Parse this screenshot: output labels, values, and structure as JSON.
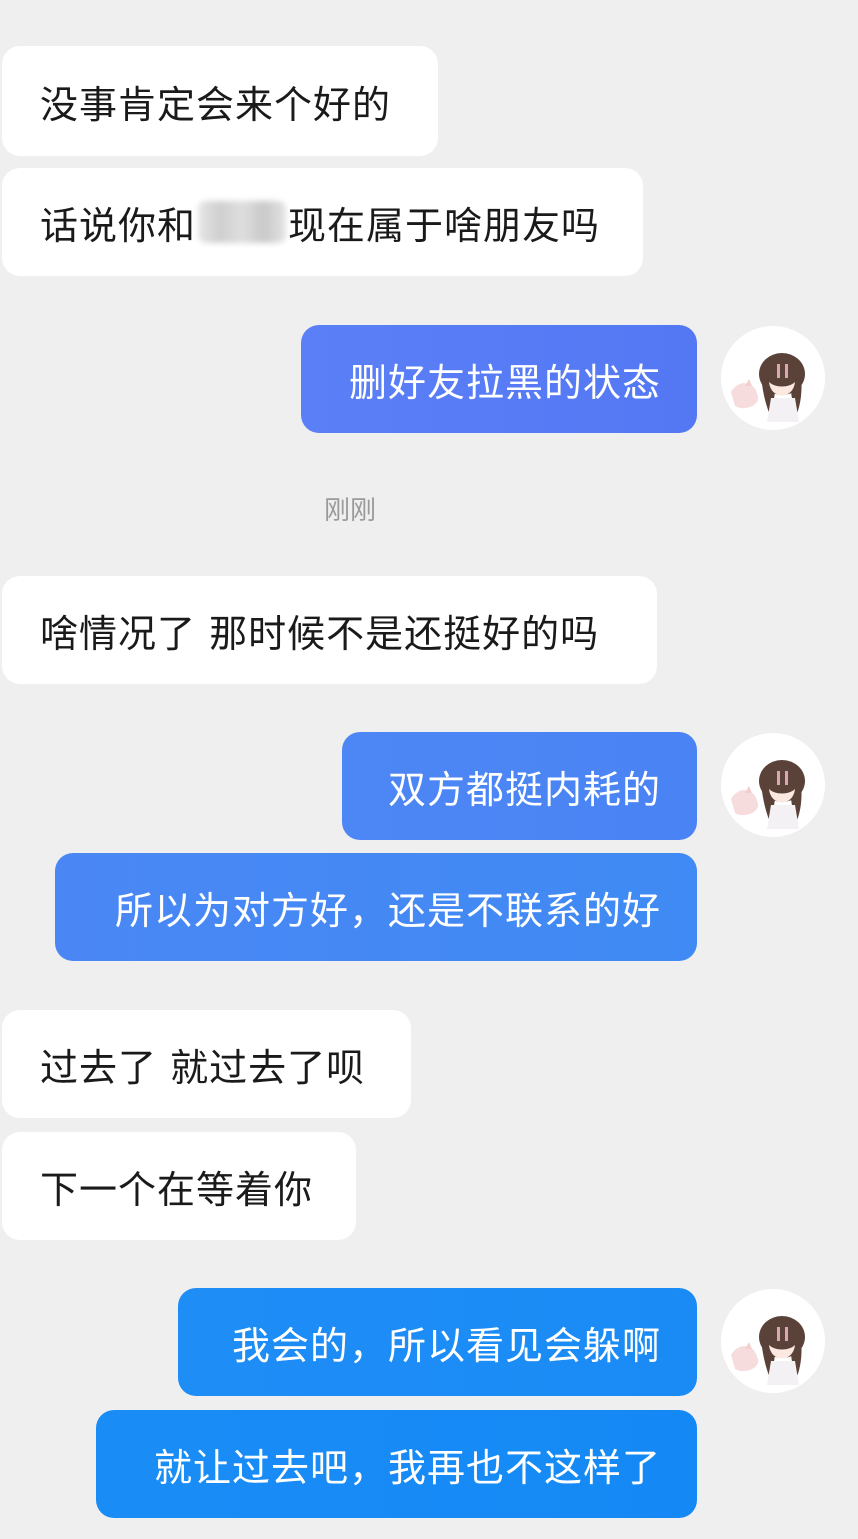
{
  "conversation": {
    "messages": [
      {
        "id": "m1",
        "side": "in",
        "text": "没事肯定会来个好的"
      },
      {
        "id": "m2",
        "side": "in",
        "text_before": "话说你和",
        "text_after": "现在属于啥朋友吗"
      },
      {
        "id": "m3",
        "side": "out",
        "text": "删好友拉黑的状态"
      },
      {
        "id": "m4",
        "side": "in",
        "text": "啥情况了 那时候不是还挺好的吗"
      },
      {
        "id": "m5",
        "side": "out",
        "text": "双方都挺内耗的"
      },
      {
        "id": "m6",
        "side": "out",
        "text": "所以为对方好，还是不联系的好"
      },
      {
        "id": "m7",
        "side": "in",
        "text": "过去了 就过去了呗"
      },
      {
        "id": "m8",
        "side": "in",
        "text": "下一个在等着你"
      },
      {
        "id": "m9",
        "side": "out",
        "text": "我会的，所以看见会躲啊"
      },
      {
        "id": "m10",
        "side": "out",
        "text": "就让过去吧，我再也不这样了"
      }
    ],
    "timestamp": "刚刚"
  },
  "avatar": {
    "icon": "anime-girl-avatar-icon"
  },
  "colors": {
    "background": "#efefef",
    "incoming_bubble": "#ffffff",
    "incoming_text": "#1a1a1a",
    "outgoing_gradient_1": [
      "#5b7ff6",
      "#5478f4"
    ],
    "outgoing_gradient_2": [
      "#4d86f5",
      "#3f8af4"
    ],
    "outgoing_gradient_3": [
      "#1f8df6",
      "#1489f5"
    ],
    "outgoing_text": "#ffffff",
    "timestamp": "#9a9a9a"
  }
}
